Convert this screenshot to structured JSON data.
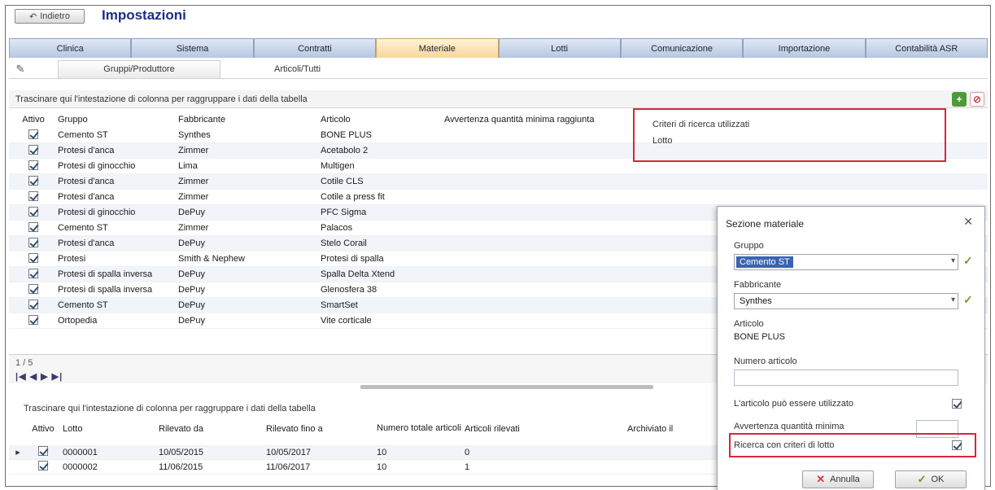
{
  "window": {
    "title": "Impostazioni",
    "back_label": "Indietro"
  },
  "tabs": [
    "Clinica",
    "Sistema",
    "Contratti",
    "Materiale",
    "Lotti",
    "Comunicazione",
    "Importazione",
    "Contabilità ASR"
  ],
  "active_tab": "Materiale",
  "subtabs": {
    "selected": "Gruppi/Produttore",
    "other": "Articoli/Tutti"
  },
  "upper_grid": {
    "hint": "Trascinare qui l'intestazione di colonna per raggruppare i dati della tabella",
    "columns": [
      "Attivo",
      "Gruppo",
      "Fabbricante",
      "Articolo",
      "Avvertenza quantità minima raggiunta",
      "Criteri di ricerca utilizzati"
    ],
    "rows": [
      {
        "attivo": true,
        "gruppo": "Cemento ST",
        "fab": "Synthes",
        "art": "BONE PLUS"
      },
      {
        "attivo": true,
        "gruppo": "Protesi d'anca",
        "fab": "Zimmer",
        "art": "Acetabolo 2"
      },
      {
        "attivo": true,
        "gruppo": "Protesi di ginocchio",
        "fab": "Lima",
        "art": "Multigen"
      },
      {
        "attivo": true,
        "gruppo": "Protesi d'anca",
        "fab": "Zimmer",
        "art": "Cotile CLS"
      },
      {
        "attivo": true,
        "gruppo": "Protesi d'anca",
        "fab": "Zimmer",
        "art": "Cotile a press fit"
      },
      {
        "attivo": true,
        "gruppo": "Protesi di ginocchio",
        "fab": "DePuy",
        "art": "PFC Sigma"
      },
      {
        "attivo": true,
        "gruppo": "Cemento ST",
        "fab": "Zimmer",
        "art": "Palacos"
      },
      {
        "attivo": true,
        "gruppo": "Protesi d'anca",
        "fab": "DePuy",
        "art": "Stelo Corail"
      },
      {
        "attivo": true,
        "gruppo": "Protesi",
        "fab": "Smith & Nephew",
        "art": "Protesi di spalla"
      },
      {
        "attivo": true,
        "gruppo": "Protesi di spalla inversa",
        "fab": "DePuy",
        "art": "Spalla Delta Xtend"
      },
      {
        "attivo": true,
        "gruppo": "Protesi di spalla inversa",
        "fab": "DePuy",
        "art": "Glenosfera 38"
      },
      {
        "attivo": true,
        "gruppo": "Cemento ST",
        "fab": "DePuy",
        "art": "SmartSet"
      },
      {
        "attivo": true,
        "gruppo": "Ortopedia",
        "fab": "DePuy",
        "art": "Vite corticale"
      }
    ]
  },
  "criteria_box": {
    "title": "Criteri di ricerca utilizzati",
    "value": "Lotto"
  },
  "pager": {
    "page": "1 / 5",
    "nav": "|◀ ◀ ▶ ▶|"
  },
  "lower_grid": {
    "hint": "Trascinare qui l'intestazione di colonna per raggruppare i dati della tabella",
    "columns": [
      "Attivo",
      "Lotto",
      "Rilevato da",
      "Rilevato fino a",
      "Numero totale articoli",
      "Articoli rilevati",
      "Archiviato il"
    ],
    "rows": [
      {
        "attivo": true,
        "lotto": "0000001",
        "da": "10/05/2015",
        "fino": "10/05/2017",
        "num": "10",
        "acq": "0"
      },
      {
        "attivo": true,
        "lotto": "0000002",
        "da": "11/06/2015",
        "fino": "11/06/2017",
        "num": "10",
        "acq": "1"
      }
    ]
  },
  "dialog": {
    "title": "Sezione materiale",
    "group_label": "Gruppo",
    "group_value": "Cemento ST",
    "manufacturer_label": "Fabbricante",
    "manufacturer_value": "Synthes",
    "article_label": "Articolo",
    "article_value": "BONE PLUS",
    "number_label": "Numero articolo",
    "number_value": "",
    "check1_label": "L'articolo può essere utilizzato",
    "qty_label": "Avvertenza quantità minima",
    "check2_label": "Ricerca con criteri di lotto",
    "cancel_label": "Annulla",
    "ok_label": "OK"
  }
}
